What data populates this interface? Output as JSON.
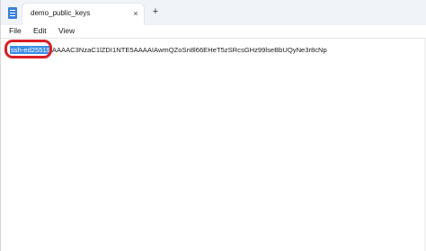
{
  "tab": {
    "title": "demo_public_keys",
    "close": "×"
  },
  "new_tab": "+",
  "menu": {
    "file": "File",
    "edit": "Edit",
    "view": "View"
  },
  "editor": {
    "selected_text": "ssh-ed25519",
    "rest_text": "AAAAC3NzaC1lZDI1NTE5AAAAIAwmQZoSn8l66EHeT5zSRcsGHz99lseBbUQyNe3r8cNp"
  },
  "colors": {
    "selection": "#3b8ce6",
    "annotation_ring": "#d81f26"
  }
}
